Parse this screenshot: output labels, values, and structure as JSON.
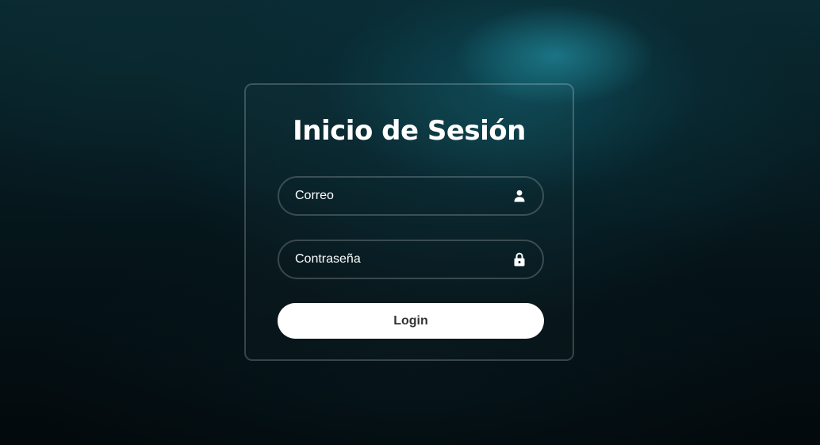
{
  "login_form": {
    "title": "Inicio de Sesión",
    "email_field": {
      "placeholder": "Correo",
      "value": "",
      "icon": "user-icon"
    },
    "password_field": {
      "placeholder": "Contraseña",
      "value": "",
      "icon": "lock-icon"
    },
    "login_button": {
      "label": "Login"
    }
  },
  "colors": {
    "background_accent": "#0a5a68",
    "button_bg": "#ffffff",
    "button_text": "#333333",
    "text": "#ffffff"
  }
}
